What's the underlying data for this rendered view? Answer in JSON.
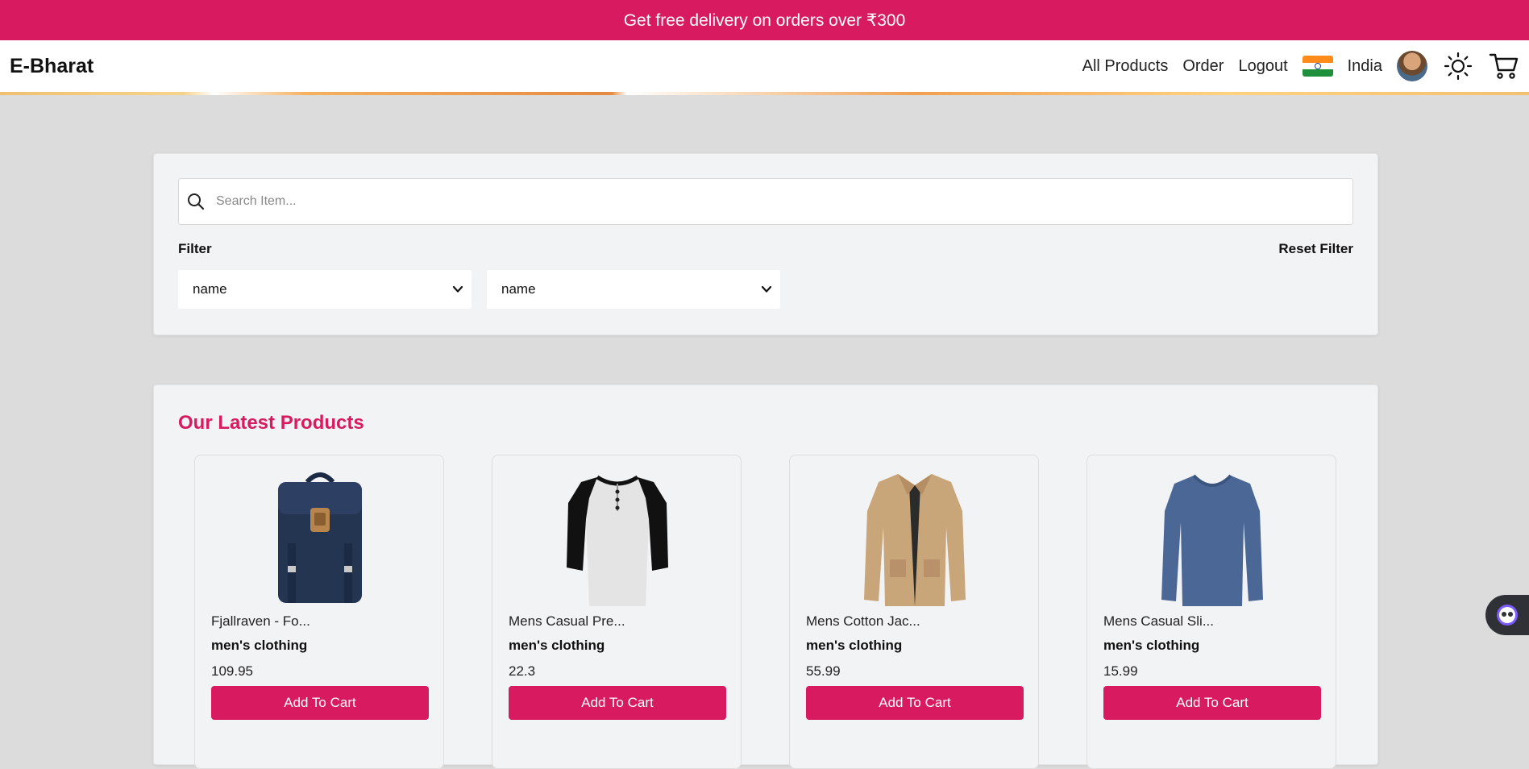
{
  "promo": {
    "text": "Get free delivery on orders over ₹300"
  },
  "nav": {
    "brand": "E-Bharat",
    "links": [
      "All Products",
      "Order",
      "Logout"
    ],
    "country": "India"
  },
  "search": {
    "placeholder": "Search Item..."
  },
  "filter": {
    "label": "Filter",
    "reset_label": "Reset Filter",
    "select1_value": "name",
    "select2_value": "name"
  },
  "products": {
    "title": "Our Latest Products",
    "button_label": "Add To Cart",
    "items": [
      {
        "title": "Fjallraven - Fo...",
        "category": "men's clothing",
        "price": "109.95"
      },
      {
        "title": "Mens Casual Pre...",
        "category": "men's clothing",
        "price": "22.3"
      },
      {
        "title": "Mens Cotton Jac...",
        "category": "men's clothing",
        "price": "55.99"
      },
      {
        "title": "Mens Casual Sli...",
        "category": "men's clothing",
        "price": "15.99"
      }
    ]
  },
  "colors": {
    "accent": "#d81b60",
    "page_bg": "#dcdcdc",
    "card_bg": "#f2f3f5"
  },
  "icons": [
    "search-icon",
    "flag-india-icon",
    "sun-icon",
    "cart-icon",
    "chatbot-icon"
  ]
}
